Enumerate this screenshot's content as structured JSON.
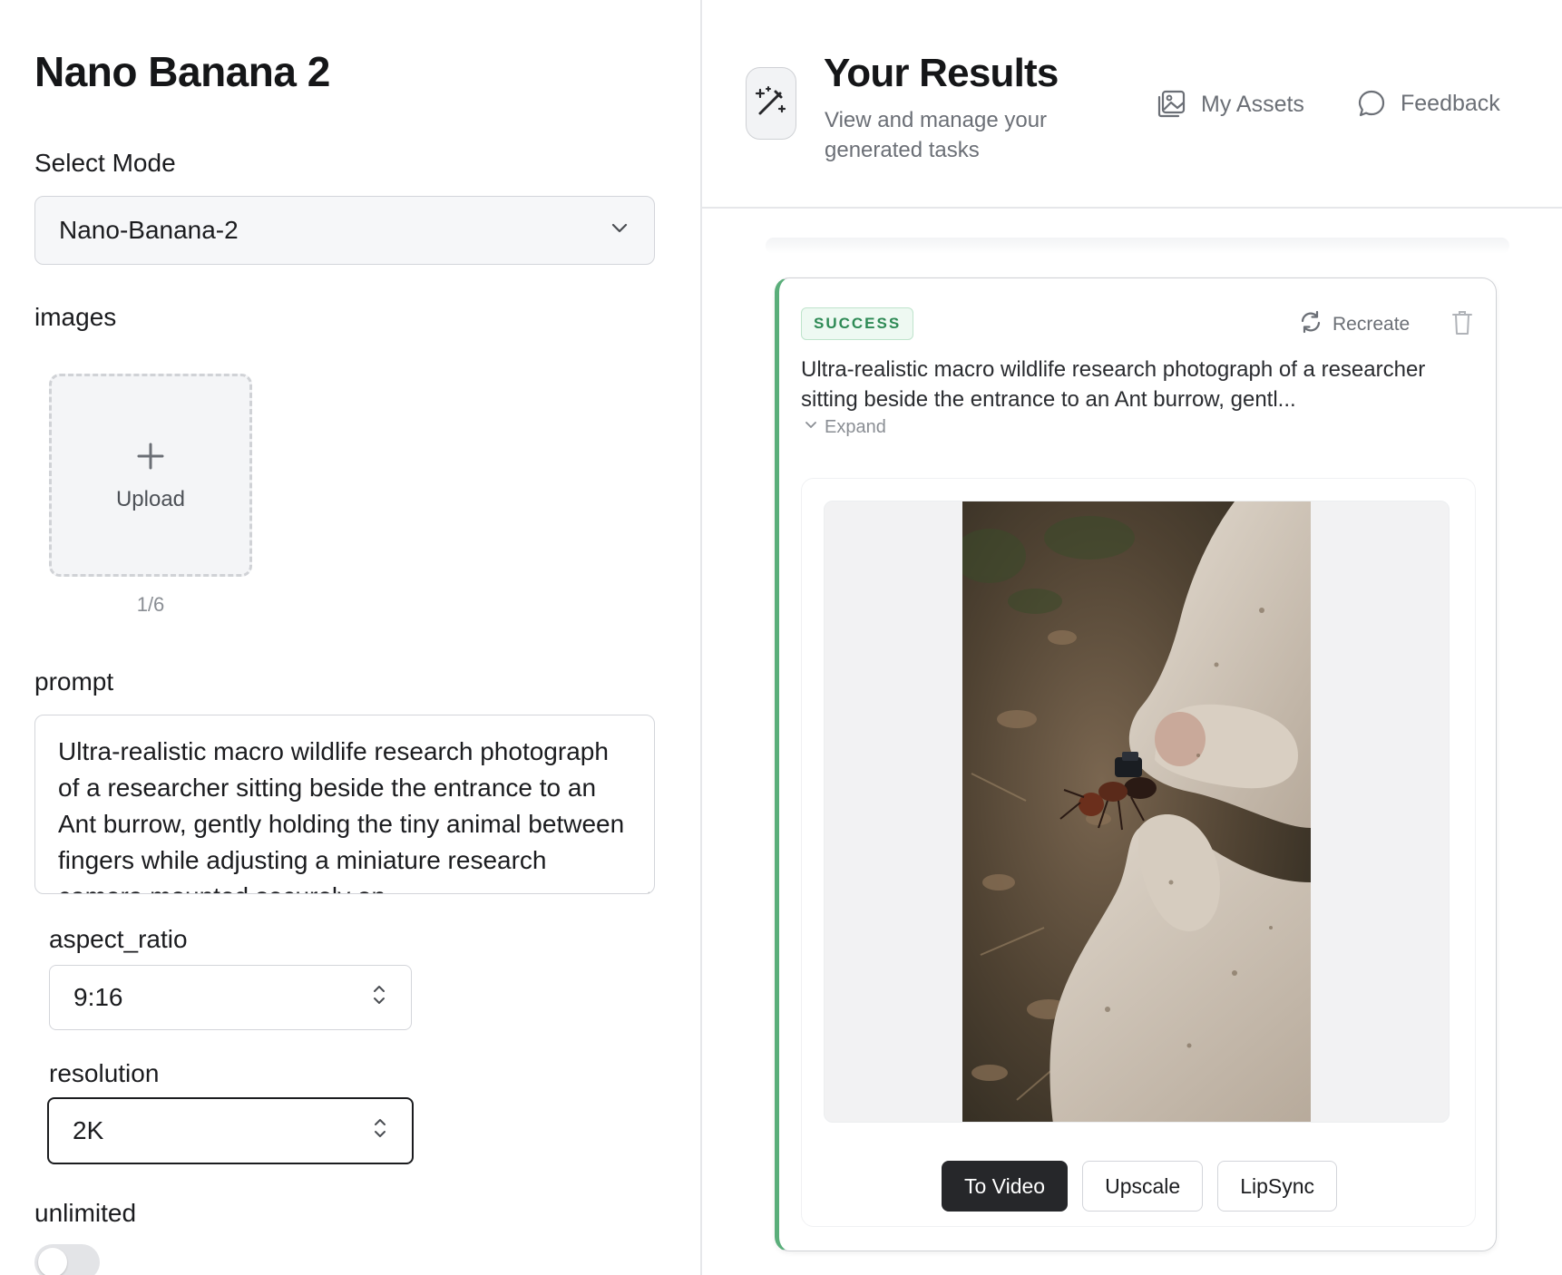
{
  "left_panel": {
    "title": "Nano Banana 2",
    "mode": {
      "label": "Select Mode",
      "value": "Nano-Banana-2"
    },
    "images": {
      "label": "images",
      "upload_label": "Upload",
      "count": "1/6"
    },
    "prompt": {
      "label": "prompt",
      "value": "Ultra-realistic macro wildlife research photograph of a researcher sitting beside the entrance to an Ant burrow, gently holding the tiny animal between fingers while adjusting a miniature research camera mounted securely on"
    },
    "aspect_ratio": {
      "label": "aspect_ratio",
      "value": "9:16"
    },
    "resolution": {
      "label": "resolution",
      "value": "2K"
    },
    "unlimited": {
      "label": "unlimited",
      "enabled": false
    }
  },
  "right_panel": {
    "title": "Your Results",
    "subtitle": "View and manage your generated tasks",
    "links": {
      "my_assets": "My Assets",
      "feedback": "Feedback"
    },
    "task": {
      "status": "SUCCESS",
      "recreate_label": "Recreate",
      "prompt_preview": "Ultra-realistic macro wildlife research photograph of a researcher sitting beside the entrance to an Ant burrow, gentl...",
      "expand_label": "Expand",
      "actions": {
        "to_video": "To Video",
        "upscale": "Upscale",
        "lipsync": "LipSync"
      }
    }
  },
  "colors": {
    "accent_success": "#5aae7a",
    "badge_text": "#2e8a55",
    "primary_button": "#26272a"
  },
  "icons": [
    "chevron-down-icon",
    "plus-icon",
    "updown-chevron-icon",
    "magic-wand-icon",
    "image-gallery-icon",
    "chat-bubble-icon",
    "refresh-icon",
    "trash-icon"
  ]
}
